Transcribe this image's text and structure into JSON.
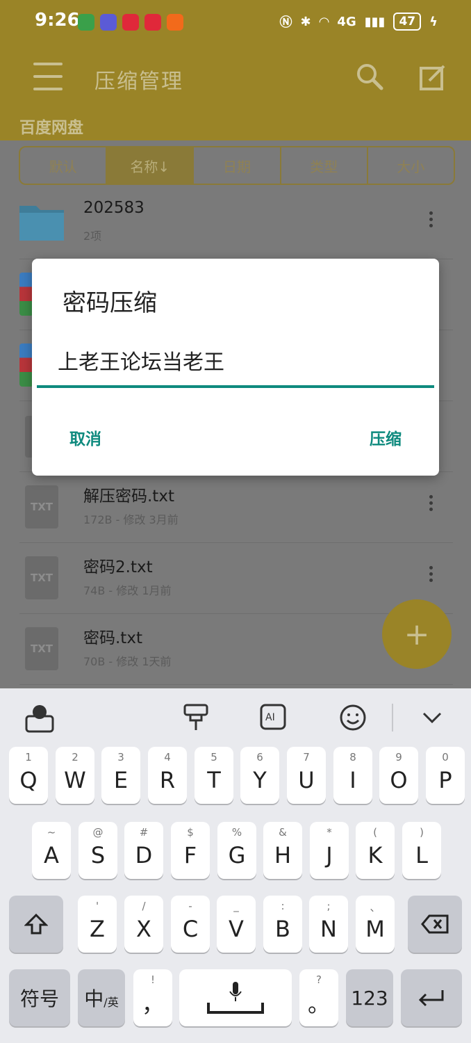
{
  "status": {
    "time": "9:26",
    "network": "4G",
    "battery": "47"
  },
  "appbar": {
    "title": "压缩管理",
    "path": "百度网盘"
  },
  "sort_tabs": [
    {
      "label": "默认"
    },
    {
      "label": "名称↓"
    },
    {
      "label": "日期"
    },
    {
      "label": "类型"
    },
    {
      "label": "大小"
    }
  ],
  "files": [
    {
      "name": "202583",
      "meta": "2项",
      "type": "folder"
    },
    {
      "name": "解压密码.txt",
      "meta": "172B - 修改 3月前",
      "type": "txt",
      "icon_label": "TXT"
    },
    {
      "name": "密码2.txt",
      "meta": "74B - 修改 1月前",
      "type": "txt",
      "icon_label": "TXT"
    },
    {
      "name": "密码.txt",
      "meta": "70B - 修改 1天前",
      "type": "txt",
      "icon_label": "TXT"
    }
  ],
  "fab": {
    "label": "+"
  },
  "dialog": {
    "title": "密码压缩",
    "input_value": "上老王论坛当老王",
    "cancel_label": "取消",
    "confirm_label": "压缩"
  },
  "keyboard": {
    "row1": [
      {
        "sub": "1",
        "main": "Q"
      },
      {
        "sub": "2",
        "main": "W"
      },
      {
        "sub": "3",
        "main": "E"
      },
      {
        "sub": "4",
        "main": "R"
      },
      {
        "sub": "5",
        "main": "T"
      },
      {
        "sub": "6",
        "main": "Y"
      },
      {
        "sub": "7",
        "main": "U"
      },
      {
        "sub": "8",
        "main": "I"
      },
      {
        "sub": "9",
        "main": "O"
      },
      {
        "sub": "0",
        "main": "P"
      }
    ],
    "row2": [
      {
        "sub": "~",
        "main": "A"
      },
      {
        "sub": "@",
        "main": "S"
      },
      {
        "sub": "#",
        "main": "D"
      },
      {
        "sub": "$",
        "main": "F"
      },
      {
        "sub": "%",
        "main": "G"
      },
      {
        "sub": "&",
        "main": "H"
      },
      {
        "sub": "*",
        "main": "J"
      },
      {
        "sub": "(",
        "main": "K"
      },
      {
        "sub": ")",
        "main": "L"
      }
    ],
    "row3": [
      {
        "sub": "'",
        "main": "Z"
      },
      {
        "sub": "/",
        "main": "X"
      },
      {
        "sub": "-",
        "main": "C"
      },
      {
        "sub": "_",
        "main": "V"
      },
      {
        "sub": ":",
        "main": "B"
      },
      {
        "sub": ";",
        "main": "N"
      },
      {
        "sub": "、",
        "main": "M"
      }
    ],
    "symbols_label": "符号",
    "lang_label": "中",
    "lang_sub": "/英",
    "comma_label": "，",
    "comma_sub": "!",
    "period_label": "。",
    "period_sub": "?",
    "num_label": "123"
  }
}
